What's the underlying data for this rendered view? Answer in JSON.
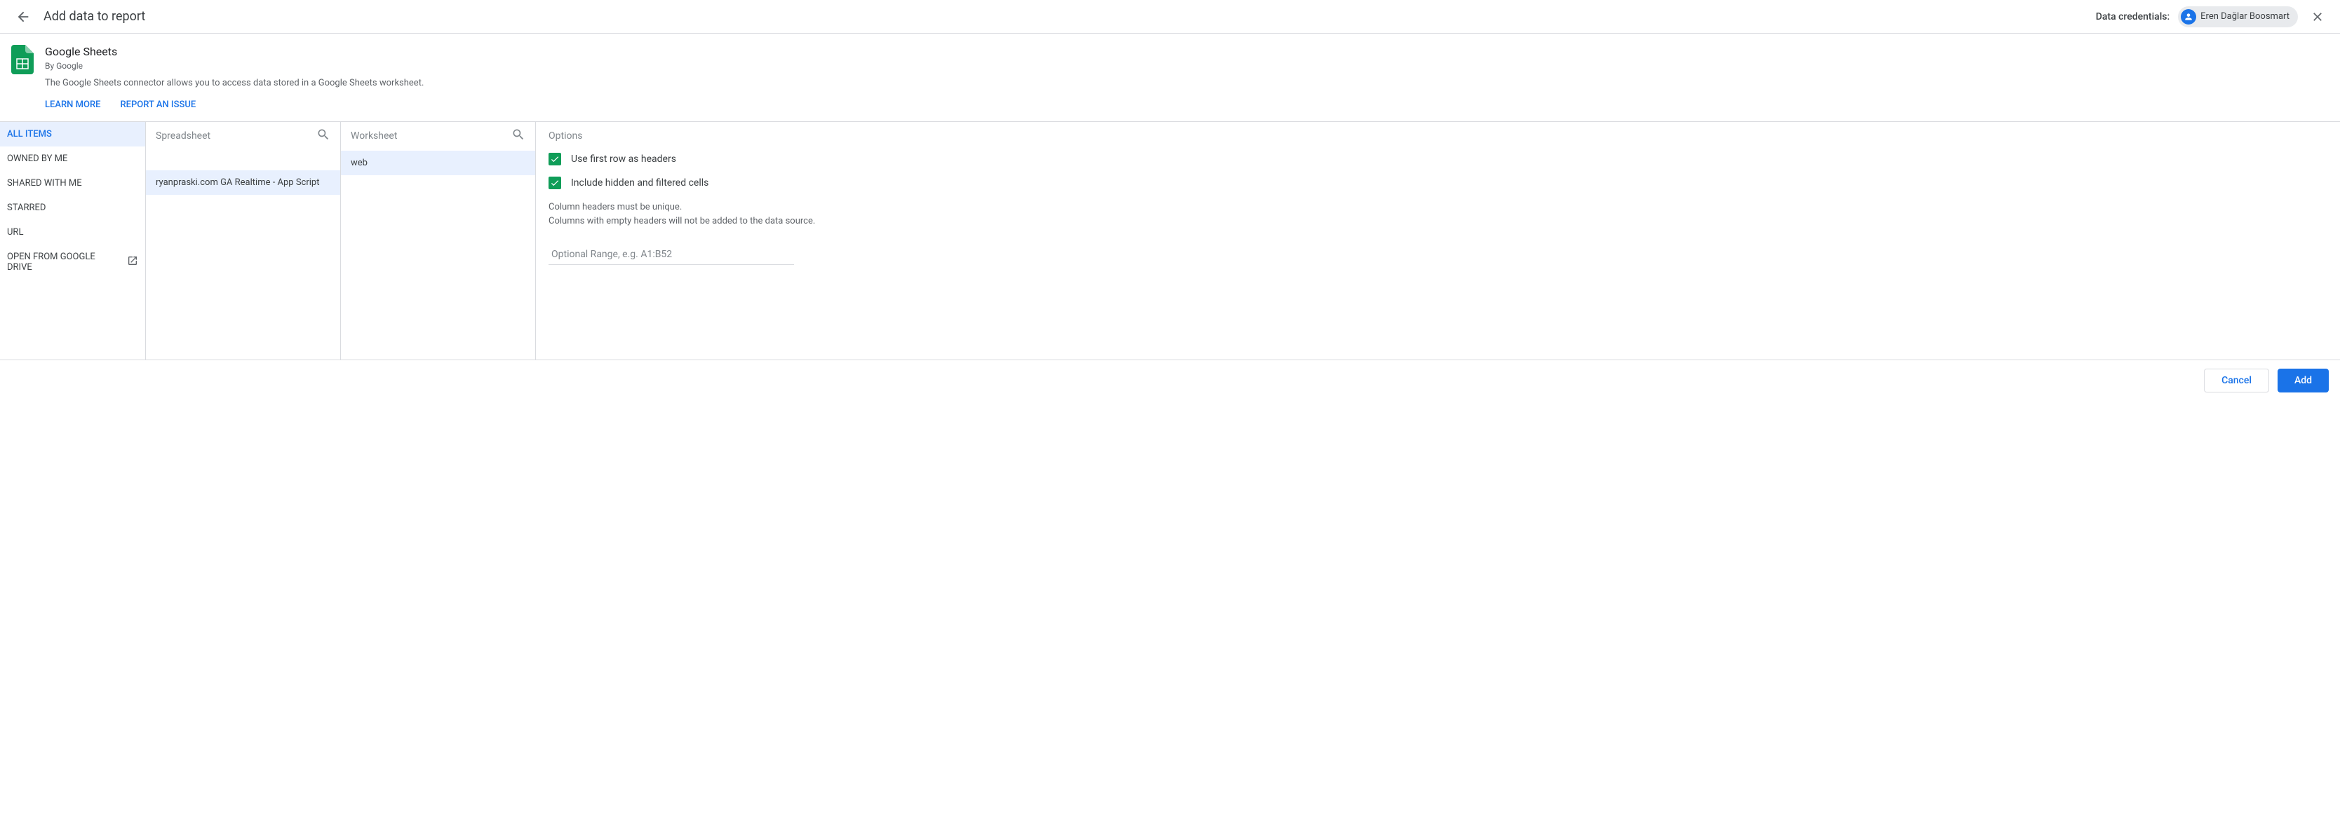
{
  "header": {
    "title": "Add data to report",
    "credentials_label": "Data credentials:",
    "user_name": "Eren Dağlar Boosmart"
  },
  "connector": {
    "name": "Google Sheets",
    "author": "By Google",
    "description": "The Google Sheets connector allows you to access data stored in a Google Sheets worksheet.",
    "learn_more": "LEARN MORE",
    "report_issue": "REPORT AN ISSUE"
  },
  "sidebar": {
    "items": [
      "ALL ITEMS",
      "OWNED BY ME",
      "SHARED WITH ME",
      "STARRED",
      "URL",
      "OPEN FROM GOOGLE DRIVE"
    ],
    "active_index": 0
  },
  "columns": {
    "spreadsheet": {
      "label": "Spreadsheet",
      "items": [
        "ryanpraski.com GA Realtime - App Script"
      ],
      "selected_index": 0
    },
    "worksheet": {
      "label": "Worksheet",
      "items": [
        "web"
      ],
      "selected_index": 0
    }
  },
  "options": {
    "title": "Options",
    "chk_first_row": "Use first row as headers",
    "chk_hidden": "Include hidden and filtered cells",
    "note_line1": "Column headers must be unique.",
    "note_line2": "Columns with empty headers will not be added to the data source.",
    "range_placeholder": "Optional Range, e.g. A1:B52"
  },
  "footer": {
    "cancel": "Cancel",
    "add": "Add"
  }
}
